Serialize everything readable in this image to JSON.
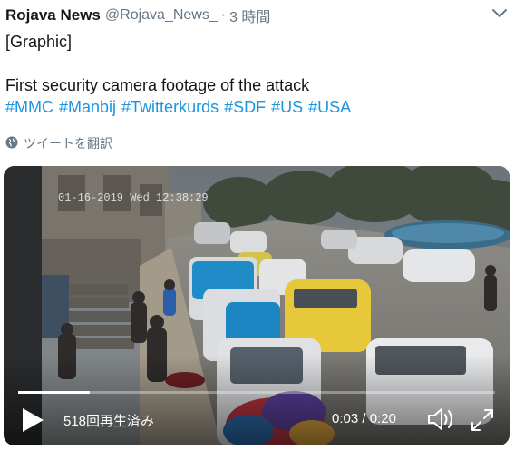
{
  "tweet": {
    "author_name": "Rojava News",
    "handle": "@Rojava_News_",
    "separator": "·",
    "time": "3 時間",
    "text_line1": "[Graphic]",
    "text_line2": "First security camera footage of the attack",
    "hashtags": [
      "#MMC",
      "#Manbij",
      "#Twitterkurds",
      "#SDF",
      "#US",
      "#USA"
    ],
    "translate_label": "ツイートを翻訳"
  },
  "video": {
    "overlay_timestamp": "01-16-2019 Wed 12:38:29",
    "views": "518回再生済み",
    "time_current": "0:03",
    "time_separator": "/",
    "time_total": "0:20",
    "progress_fraction": 0.15
  },
  "icons": {
    "caret": "chevron-down-icon",
    "globe": "globe-icon",
    "play": "play-icon",
    "volume": "volume-icon",
    "fullscreen": "fullscreen-icon"
  },
  "colors": {
    "link": "#1b95e0",
    "secondary_text": "#657786",
    "primary_text": "#14171a"
  }
}
